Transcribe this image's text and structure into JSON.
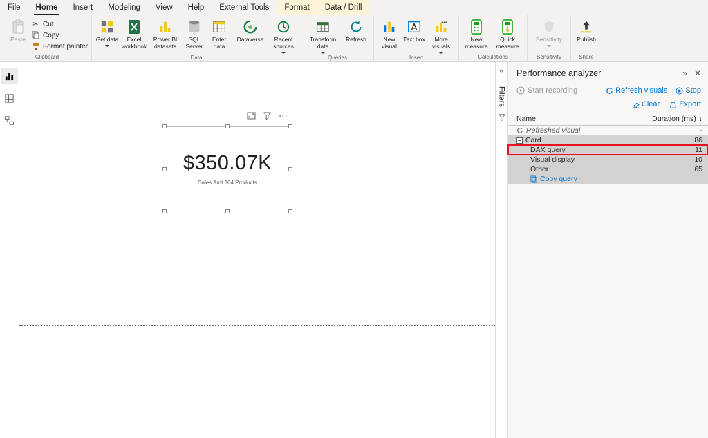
{
  "tabs": [
    {
      "label": "File"
    },
    {
      "label": "Home"
    },
    {
      "label": "Insert"
    },
    {
      "label": "Modeling"
    },
    {
      "label": "View"
    },
    {
      "label": "Help"
    },
    {
      "label": "External Tools"
    },
    {
      "label": "Format"
    },
    {
      "label": "Data / Drill"
    }
  ],
  "ribbon": {
    "clipboard": {
      "caption": "Clipboard",
      "paste": "Paste",
      "cut": "Cut",
      "copy": "Copy",
      "format_painter": "Format painter"
    },
    "data": {
      "caption": "Data",
      "get_data": "Get data",
      "excel": "Excel workbook",
      "datasets": "Power BI datasets",
      "sql": "SQL Server",
      "enter": "Enter data",
      "dataverse": "Dataverse",
      "recent": "Recent sources"
    },
    "queries": {
      "caption": "Queries",
      "transform": "Transform data",
      "refresh": "Refresh"
    },
    "insert": {
      "caption": "Insert",
      "new_visual": "New visual",
      "text_box": "Text box",
      "more_visuals": "More visuals"
    },
    "calculations": {
      "caption": "Calculations",
      "new_measure": "New measure",
      "quick_measure": "Quick measure"
    },
    "sensitivity": {
      "caption": "Sensitivity",
      "sensitivity": "Sensitivity"
    },
    "share": {
      "caption": "Share",
      "publish": "Publish"
    }
  },
  "canvas": {
    "card": {
      "value": "$350.07K",
      "caption": "Sales Amt 364 Products"
    },
    "more_options": "⋯"
  },
  "filters": {
    "label": "Filters",
    "expand_icon": "«"
  },
  "perf": {
    "title": "Performance analyzer",
    "collapse_icon": "»",
    "close_icon": "✕",
    "start_recording": "Start recording",
    "refresh_visuals": "Refresh visuals",
    "stop": "Stop",
    "clear": "Clear",
    "export": "Export",
    "col_name": "Name",
    "col_duration": "Duration (ms)",
    "sort_icon": "↓",
    "rows": [
      {
        "name": "Refreshed visual",
        "duration": "-"
      },
      {
        "name": "Card",
        "duration": "86"
      },
      {
        "name": "DAX query",
        "duration": "11"
      },
      {
        "name": "Visual display",
        "duration": "10"
      },
      {
        "name": "Other",
        "duration": "65"
      },
      {
        "name": "Copy query",
        "duration": ""
      }
    ]
  },
  "colors": {
    "accent_yellow": "#f2c811",
    "link_blue": "#0078d4",
    "highlight_red": "#e81123"
  }
}
